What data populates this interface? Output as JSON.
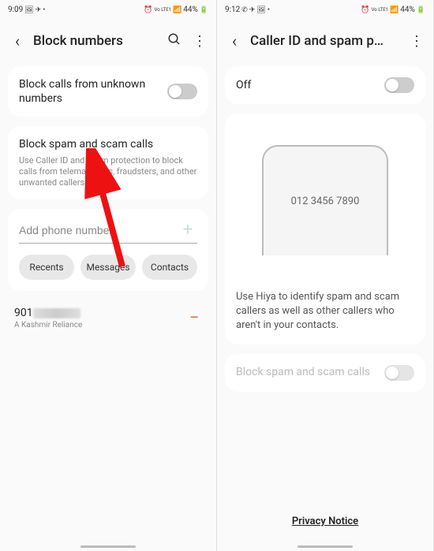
{
  "left": {
    "status": {
      "time": "9:09",
      "battery": "44%",
      "signal_label": "Vo LTE1"
    },
    "header": {
      "title": "Block numbers"
    },
    "block_unknown": {
      "title": "Block calls from unknown numbers"
    },
    "block_spam": {
      "title": "Block spam and scam calls",
      "desc": "Use Caller ID and spam protection to block calls from telemarketers, fraudsters, and other unwanted callers."
    },
    "add_number": {
      "placeholder": "Add phone number"
    },
    "chips": {
      "recents": "Recents",
      "messages": "Messages",
      "contacts": "Contacts"
    },
    "blocked": {
      "number_prefix": "901",
      "label": "A Kashmir Reliance"
    }
  },
  "right": {
    "status": {
      "time": "9:12",
      "battery": "44%",
      "signal_label": "Vo LTE1"
    },
    "header": {
      "title": "Caller ID and spam p…"
    },
    "off_toggle": {
      "label": "Off"
    },
    "phone_preview": {
      "number": "012 3456 7890"
    },
    "info": "Use Hiya to identify spam and scam callers as well as other callers who aren't in your contacts.",
    "block_spam_toggle": {
      "label": "Block spam and scam calls"
    },
    "privacy": "Privacy Notice"
  }
}
